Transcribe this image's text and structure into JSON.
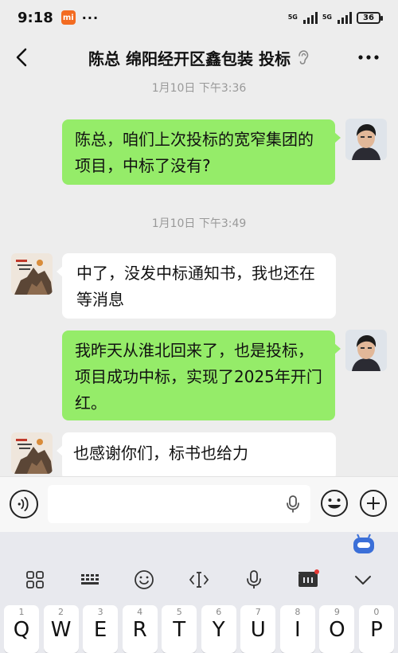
{
  "status": {
    "time": "9:18",
    "mi": "mi",
    "dots": "···",
    "sig1_label": "5G",
    "sig2_label": "5G",
    "battery": "36"
  },
  "header": {
    "title": "陈总 绵阳经开区鑫包装 投标"
  },
  "chat": {
    "stamp1": "1月10日 下午3:36",
    "stamp2": "1月10日 下午3:49",
    "messages": [
      {
        "from": "me",
        "text": "陈总，咱们上次投标的宽窄集团的项目，中标了没有?"
      },
      {
        "from": "them",
        "text": "中了，没发中标通知书，我也还在等消息"
      },
      {
        "from": "me",
        "text": "我昨天从淮北回来了，也是投标，项目成功中标，实现了2025年开门红。"
      },
      {
        "from": "them",
        "text": "也感谢你们，标书也给力"
      }
    ]
  },
  "input": {
    "value": ""
  },
  "keyboard": {
    "keys": [
      {
        "num": "1",
        "letter": "Q"
      },
      {
        "num": "2",
        "letter": "W"
      },
      {
        "num": "3",
        "letter": "E"
      },
      {
        "num": "4",
        "letter": "R"
      },
      {
        "num": "5",
        "letter": "T"
      },
      {
        "num": "6",
        "letter": "Y"
      },
      {
        "num": "7",
        "letter": "U"
      },
      {
        "num": "8",
        "letter": "I"
      },
      {
        "num": "9",
        "letter": "O"
      },
      {
        "num": "0",
        "letter": "P"
      }
    ],
    "toolbar_icons": [
      "apps-icon",
      "keyboard-icon",
      "emoji-icon",
      "cursor-icon",
      "mic-icon",
      "mi-icon",
      "chevron-down-icon"
    ]
  }
}
